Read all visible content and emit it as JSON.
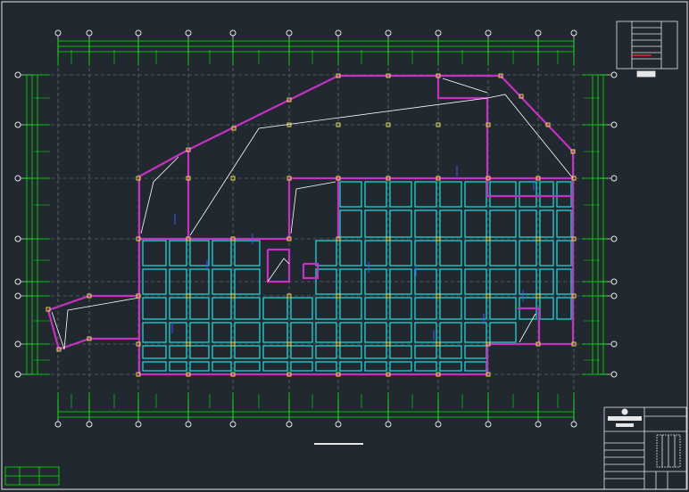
{
  "drawing": {
    "background": "#212830",
    "colors": {
      "frame": "#e6e6e6",
      "axis": "#00ee00",
      "grid_dash": "#7a7f86",
      "wall": "#c531c0",
      "beam": "#1fd3d3",
      "column": "#e6d84a",
      "annotation": "#ffffff",
      "dim_tick": "#3a57ff",
      "note_red": "#ff2a2a"
    },
    "title_block_icons": [
      "seal-icon",
      "logo-bar-icon"
    ]
  }
}
